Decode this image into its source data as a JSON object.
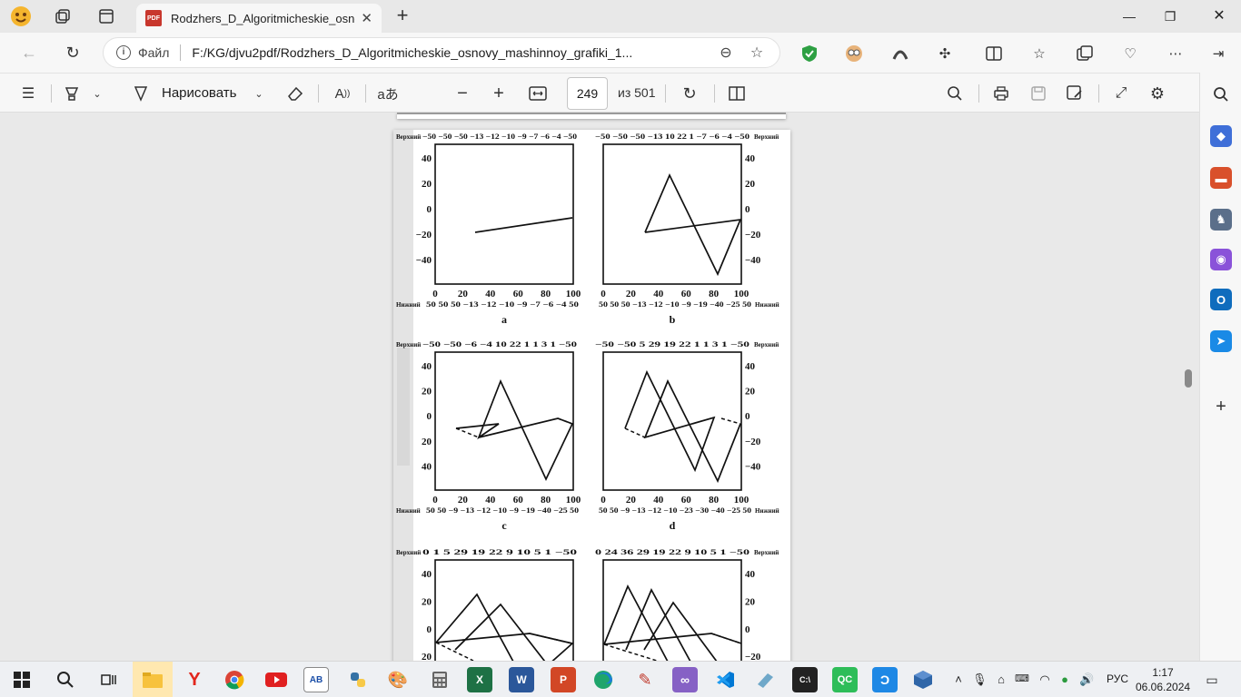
{
  "tab": {
    "title": "Rodzhers_D_Algoritmicheskie_osnovy_mashinnoy_grafiki_1",
    "badge": "PDF"
  },
  "address": {
    "label": "Файл",
    "url": "F:/KG/djvu2pdf/Rodzhers_D_Algoritmicheskie_osnovy_mashinnoy_grafiki_1..."
  },
  "pdf_toolbar": {
    "draw_label": "Нарисовать",
    "text_tool": "aあ",
    "page_current": "249",
    "page_total": "из 501"
  },
  "taskbar": {
    "lang": "РУС",
    "time": "1:17",
    "date": "06.06.2024"
  },
  "figure": {
    "top_label": "Верхний",
    "bottom_label": "Нижний",
    "panels": [
      {
        "caption": "a",
        "top_values": "−50 −50 −50 −13 −12 −10 −9  −7  −6  −4 −50",
        "bottom_values": "50  50  50 −13 −12 −10  −9  −7  −6  −4  50"
      },
      {
        "caption": "b",
        "top_values": "−50 −50 −50 −13  10  22  1  −7  −6  −4 −50",
        "bottom_values": "50  50  50 −13 −12 −10 −9 −19 −40 −25  50"
      },
      {
        "caption": "c",
        "top_values": "−50 −50 −6  −4  10  22  1  1  3  1 −50",
        "bottom_values": "50  50 −9 −13 −12 −10 −9 −19 −40 −25  50"
      },
      {
        "caption": "d",
        "top_values": "−50 −50  5  29  19  22  1  1  3  1 −50",
        "bottom_values": "50  50 −9 −13 −12 −10 −23 −30 −40 −25  50"
      },
      {
        "caption": "",
        "top_values": "0  1  5  29  19  22  9  10  5  1 −50",
        "bottom_values": ""
      },
      {
        "caption": "",
        "top_values": "0  24  36  29  19  22  9  10  5  1 −50",
        "bottom_values": ""
      }
    ],
    "x_ticks": [
      "0",
      "20",
      "40",
      "60",
      "80",
      "100"
    ],
    "y_ticks": [
      "40",
      "20",
      "0",
      "−20",
      "−40"
    ],
    "y_ticks_left_c": [
      "40",
      "20",
      "0",
      "20",
      "40"
    ],
    "y_ticks_left_e": [
      "40",
      "20",
      "0",
      "20"
    ]
  }
}
